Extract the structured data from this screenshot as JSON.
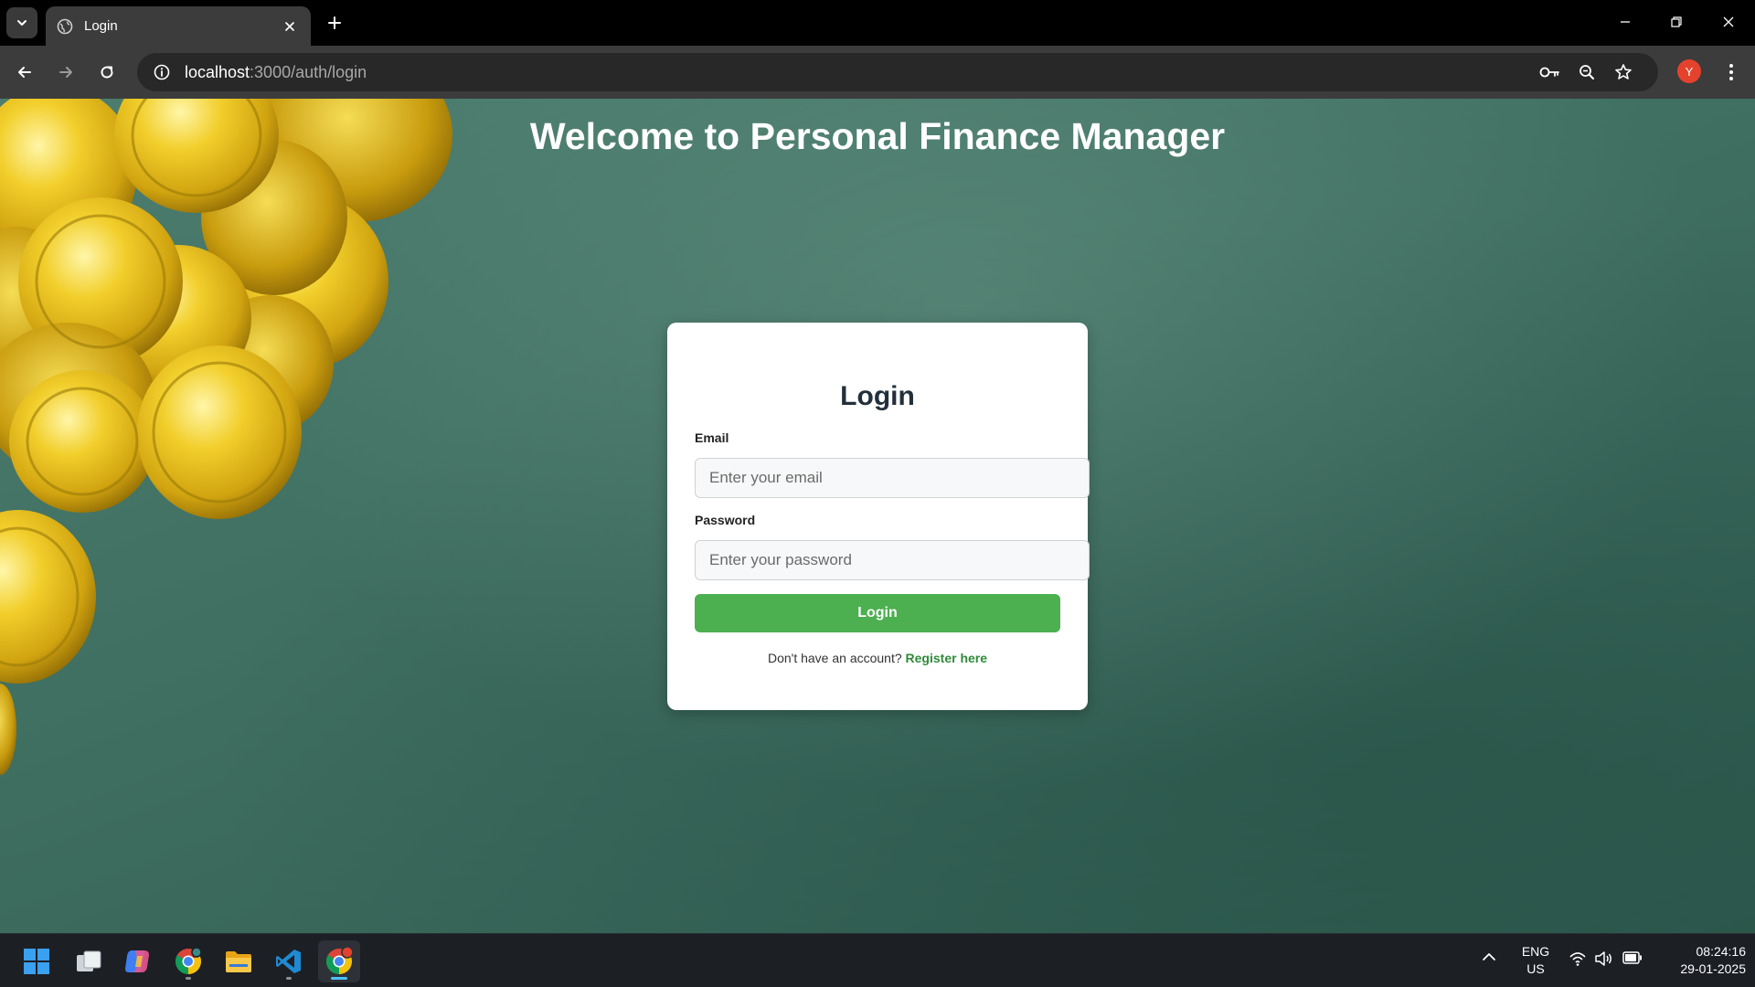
{
  "browser": {
    "tab_title": "Login",
    "url_host": "localhost",
    "url_rest": ":3000/auth/login",
    "profile_initial": "Y"
  },
  "page": {
    "heading": "Welcome to Personal Finance Manager",
    "card_title": "Login",
    "email_label": "Email",
    "email_placeholder": "Enter your email",
    "password_label": "Password",
    "password_placeholder": "Enter your password",
    "login_button": "Login",
    "register_prompt": "Don't have an account?",
    "register_link": "Register here"
  },
  "taskbar": {
    "lang_top": "ENG",
    "lang_bottom": "US",
    "time": "08:24:16",
    "date": "29-01-2025"
  },
  "colors": {
    "accent_green": "#4caf50",
    "link_green": "#2e8b3a",
    "background_green": "#3f6f61",
    "profile_red": "#e4422c"
  }
}
